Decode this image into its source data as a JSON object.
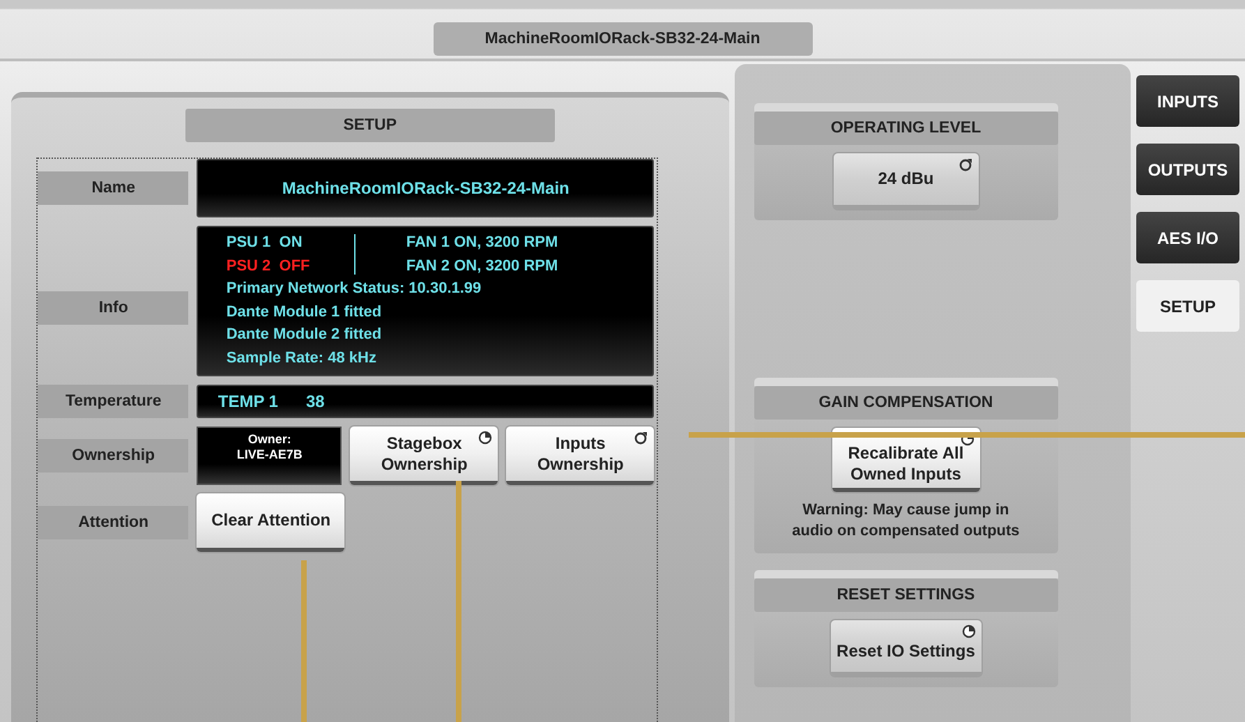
{
  "window": {
    "title": "MachineRoomIORack-SB32-24-Main"
  },
  "setup": {
    "title": "SETUP",
    "name": {
      "label": "Name",
      "value": "MachineRoomIORack-SB32-24-Main"
    },
    "info": {
      "label": "Info",
      "psu": [
        {
          "text": "PSU 1  ON",
          "fault": false
        },
        {
          "text": "PSU 2  OFF",
          "fault": true
        }
      ],
      "fans": [
        {
          "text": "FAN 1 ON, 3200 RPM",
          "fault": false
        },
        {
          "text": "FAN 2 ON, 3200 RPM",
          "fault": false
        }
      ],
      "lines": [
        "Primary Network Status:  10.30.1.99",
        "Dante Module 1 fitted",
        "Dante Module 2 fitted",
        "Sample Rate:  48 kHz"
      ]
    },
    "temperature": {
      "label": "Temperature",
      "sensor": "TEMP 1",
      "value": "38"
    },
    "ownership": {
      "label": "Ownership",
      "owner_caption": "Owner:",
      "owner": "LIVE-AE7B",
      "buttons": [
        {
          "label": "Stagebox Ownership",
          "kind": "pie"
        },
        {
          "label": "Inputs Ownership",
          "kind": "knob"
        }
      ]
    },
    "attention": {
      "label": "Attention",
      "button": "Clear Attention"
    }
  },
  "operating_level": {
    "title": "OPERATING LEVEL",
    "button": "24 dBu",
    "kind": "knob"
  },
  "gain_compensation": {
    "title": "GAIN COMPENSATION",
    "button": "Recalibrate All Owned Inputs",
    "kind": "pie",
    "warning": "Warning: May cause jump in audio on compensated outputs"
  },
  "reset_settings": {
    "title": "RESET SETTINGS",
    "button": "Reset IO Settings",
    "kind": "pie"
  },
  "tabs": [
    {
      "label": "INPUTS",
      "selected": false
    },
    {
      "label": "OUTPUTS",
      "selected": false
    },
    {
      "label": "AES I/O",
      "selected": false
    },
    {
      "label": "SETUP",
      "selected": true
    }
  ]
}
